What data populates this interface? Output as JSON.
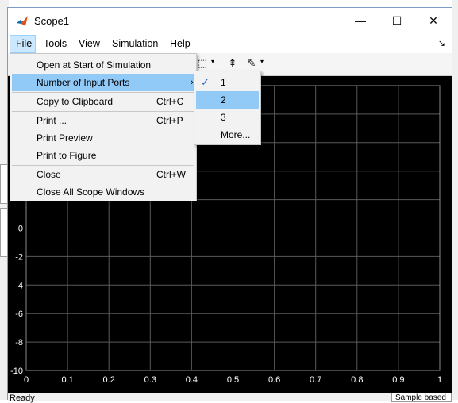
{
  "window": {
    "title": "Scope1",
    "min_glyph": "—",
    "max_glyph": "☐",
    "close_glyph": "✕"
  },
  "menubar": {
    "items": [
      "File",
      "Tools",
      "View",
      "Simulation",
      "Help"
    ],
    "right_icon": "↘"
  },
  "file_menu": {
    "items": [
      {
        "label": "Open at Start of Simulation",
        "shortcut": ""
      },
      {
        "label": "Number of Input Ports",
        "shortcut": "",
        "submenu_arrow": "›"
      },
      {
        "label": "Copy to Clipboard",
        "shortcut": "Ctrl+C"
      },
      {
        "label": "Print ...",
        "shortcut": "Ctrl+P"
      },
      {
        "label": "Print Preview",
        "shortcut": ""
      },
      {
        "label": "Print to Figure",
        "shortcut": ""
      },
      {
        "label": "Close",
        "shortcut": "Ctrl+W"
      },
      {
        "label": "Close All Scope Windows",
        "shortcut": ""
      }
    ]
  },
  "ports_submenu": {
    "items": [
      "1",
      "2",
      "3",
      "More..."
    ],
    "checked": "1",
    "highlighted": "2",
    "check_glyph": "✓"
  },
  "toolbar": {
    "icons": [
      "zoom-icon",
      "scale-axes-icon",
      "pen-icon"
    ],
    "dropdown_glyph": "▾"
  },
  "plot": {
    "x_ticks": [
      "0",
      "0.1",
      "0.2",
      "0.3",
      "0.4",
      "0.5",
      "0.6",
      "0.7",
      "0.8",
      "0.9",
      "1"
    ],
    "y_ticks": [
      "0",
      "-2",
      "-4",
      "-6",
      "-8",
      "-10"
    ],
    "xlim": [
      0,
      1
    ],
    "ylim": [
      -10,
      10
    ],
    "background": "#000000",
    "grid_color": "#5a5a5a",
    "grid": true
  },
  "status": {
    "text": "Ready",
    "right_text": "Sample based"
  },
  "colors": {
    "highlight": "#91c9f7",
    "menu_bg": "#f2f2f2",
    "window_border": "#7a9cc6"
  }
}
